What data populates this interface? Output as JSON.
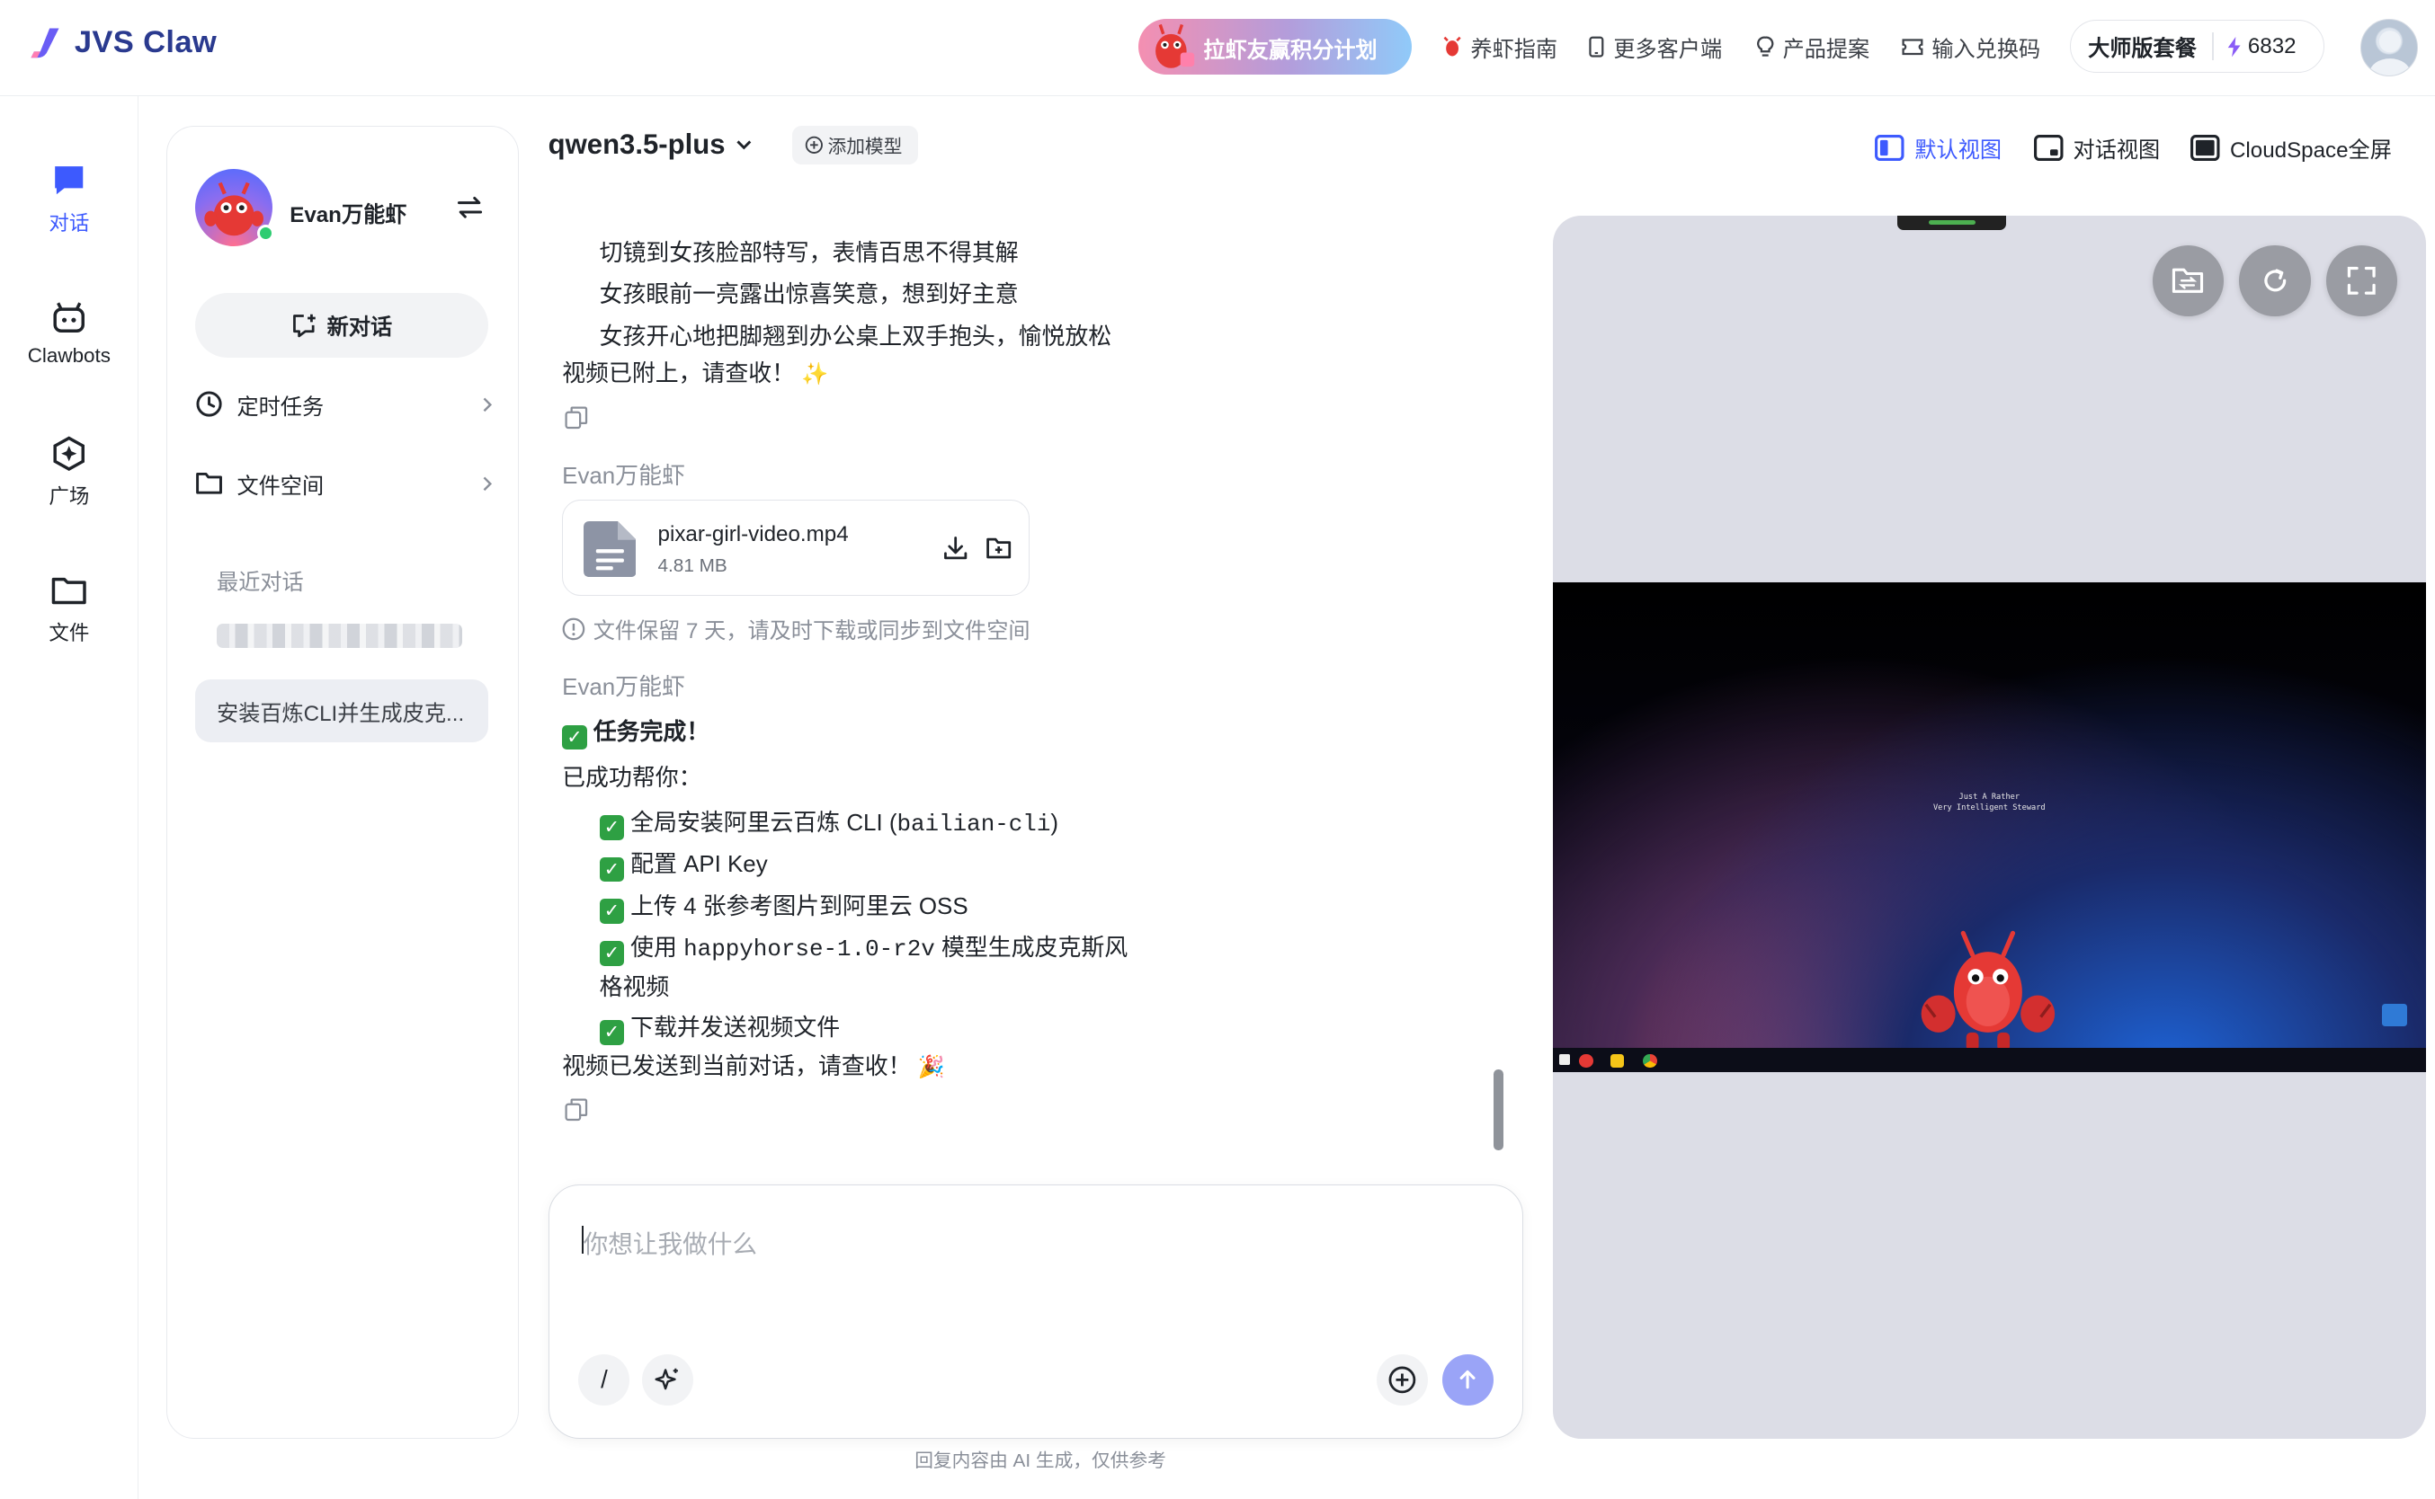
{
  "app": {
    "title": "JVS Claw"
  },
  "topbar": {
    "promo": "拉虾友赢积分计划",
    "nav": [
      {
        "label": "养虾指南",
        "icon": "lobster-icon"
      },
      {
        "label": "更多客户端",
        "icon": "phone-icon"
      },
      {
        "label": "产品提案",
        "icon": "lightbulb-icon"
      },
      {
        "label": "输入兑换码",
        "icon": "ticket-icon"
      }
    ],
    "plan": "大师版套餐",
    "credits": "6832"
  },
  "rail": [
    {
      "label": "对话",
      "icon": "chat-icon",
      "active": true
    },
    {
      "label": "Clawbots",
      "icon": "bot-icon",
      "active": false
    },
    {
      "label": "广场",
      "icon": "plaza-icon",
      "active": false
    },
    {
      "label": "文件",
      "icon": "folder-icon",
      "active": false
    }
  ],
  "panel": {
    "user_name": "Evan万能虾",
    "new_chat": "新对话",
    "scheduled": "定时任务",
    "file_space": "文件空间",
    "recent_title": "最近对话",
    "conversation": "安装百炼CLI并生成皮克..."
  },
  "header": {
    "model": "qwen3.5-plus",
    "add_model": "添加模型",
    "views": [
      "默认视图",
      "对话视图",
      "CloudSpace全屏"
    ]
  },
  "messages": {
    "story_lines": [
      "切镜到女孩脸部特写，表情百思不得其解",
      "女孩眼前一亮露出惊喜笑意，想到好主意",
      "女孩开心地把脚翘到办公桌上双手抱头，愉悦放松"
    ],
    "video_attached": "视频已附上，请查收！",
    "sender": "Evan万能虾",
    "file": {
      "name": "pixar-girl-video.mp4",
      "size": "4.81 MB"
    },
    "retention": "文件保留 7 天，请及时下载或同步到文件空间",
    "task_done": "任务完成！",
    "success_intro": "已成功帮你：",
    "steps": {
      "s1_a": "全局安装阿里云百炼 CLI (",
      "s1_code": "bailian-cli",
      "s1_b": ")",
      "s2": "配置 API Key",
      "s3": "上传 4 张参考图片到阿里云 OSS",
      "s4_a": "使用 ",
      "s4_code": "happyhorse-1.0-r2v",
      "s4_b": " 模型生成皮克斯风",
      "s4_c": "格视频",
      "s5": "下载并发送视频文件"
    },
    "sent": "视频已发送到当前对话，请查收！"
  },
  "input": {
    "placeholder": "你想让我做什么",
    "slash": "/"
  },
  "disclaimer": "回复内容由 AI 生成，仅供参考",
  "cloud": {
    "desktop_text_1": "Just A Rather",
    "desktop_text_2": "Very Intelligent Steward"
  },
  "colors": {
    "accent": "#3d5afe",
    "brand": "#2a3a8f",
    "success": "#2ea043"
  }
}
